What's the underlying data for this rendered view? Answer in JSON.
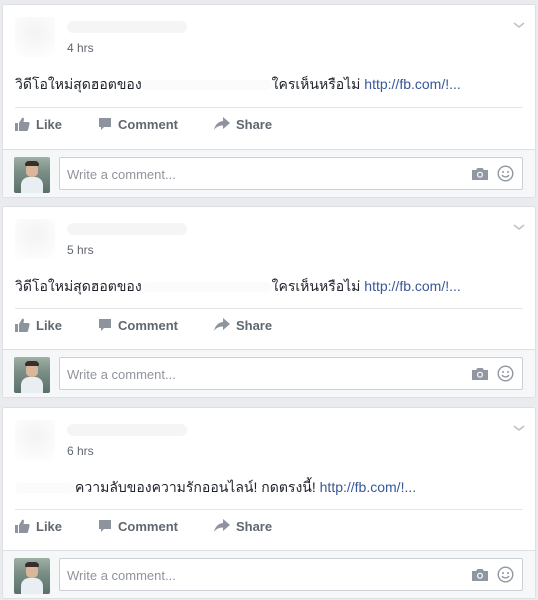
{
  "posts": [
    {
      "time": "4 hrs",
      "text_before": "วิดีโอใหม่สุดฮอตของ",
      "text_after": "ใครเห็นหรือไม่",
      "link": "http://fb.com/!..."
    },
    {
      "time": "5 hrs",
      "text_before": "วิดีโอใหม่สุดฮอตของ",
      "text_after": "ใครเห็นหรือไม่",
      "link": "http://fb.com/!..."
    },
    {
      "time": "6 hrs",
      "text_before": "",
      "text_after": "ความลับของความรักออนไลน์! กดตรงนี้!",
      "link": "http://fb.com/!..."
    }
  ],
  "actions": {
    "like": "Like",
    "comment": "Comment",
    "share": "Share"
  },
  "comment_box": {
    "placeholder": "Write a comment..."
  },
  "colors": {
    "link": "#365899",
    "action_text": "#606770",
    "background": "#e9ebee"
  }
}
